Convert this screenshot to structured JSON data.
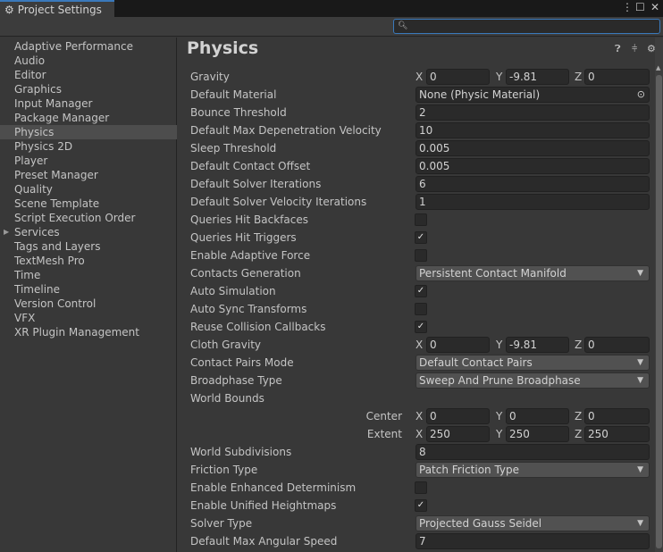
{
  "window": {
    "title": "Project Settings",
    "search_placeholder": ""
  },
  "sidebar": {
    "selected": "Physics",
    "items": [
      {
        "label": "Adaptive Performance"
      },
      {
        "label": "Audio"
      },
      {
        "label": "Editor"
      },
      {
        "label": "Graphics"
      },
      {
        "label": "Input Manager"
      },
      {
        "label": "Package Manager"
      },
      {
        "label": "Physics"
      },
      {
        "label": "Physics 2D"
      },
      {
        "label": "Player"
      },
      {
        "label": "Preset Manager"
      },
      {
        "label": "Quality"
      },
      {
        "label": "Scene Template"
      },
      {
        "label": "Script Execution Order"
      },
      {
        "label": "Services",
        "expandable": true
      },
      {
        "label": "Tags and Layers"
      },
      {
        "label": "TextMesh Pro"
      },
      {
        "label": "Time"
      },
      {
        "label": "Timeline"
      },
      {
        "label": "Version Control"
      },
      {
        "label": "VFX"
      },
      {
        "label": "XR Plugin Management"
      }
    ]
  },
  "main": {
    "title": "Physics",
    "rows": [
      {
        "label": "Gravity",
        "type": "vector",
        "x": "0",
        "y": "-9.81",
        "z": "0"
      },
      {
        "label": "Default Material",
        "type": "object",
        "value": "None (Physic Material)"
      },
      {
        "label": "Bounce Threshold",
        "type": "text",
        "value": "2"
      },
      {
        "label": "Default Max Depenetration Velocity",
        "type": "text",
        "value": "10"
      },
      {
        "label": "Sleep Threshold",
        "type": "text",
        "value": "0.005"
      },
      {
        "label": "Default Contact Offset",
        "type": "text",
        "value": "0.005"
      },
      {
        "label": "Default Solver Iterations",
        "type": "text",
        "value": "6"
      },
      {
        "label": "Default Solver Velocity Iterations",
        "type": "text",
        "value": "1"
      },
      {
        "label": "Queries Hit Backfaces",
        "type": "check",
        "checked": false
      },
      {
        "label": "Queries Hit Triggers",
        "type": "check",
        "checked": true
      },
      {
        "label": "Enable Adaptive Force",
        "type": "check",
        "checked": false
      },
      {
        "label": "Contacts Generation",
        "type": "dropdown",
        "value": "Persistent Contact Manifold"
      },
      {
        "label": "Auto Simulation",
        "type": "check",
        "checked": true
      },
      {
        "label": "Auto Sync Transforms",
        "type": "check",
        "checked": false
      },
      {
        "label": "Reuse Collision Callbacks",
        "type": "check",
        "checked": true
      },
      {
        "label": "Cloth Gravity",
        "type": "vector",
        "x": "0",
        "y": "-9.81",
        "z": "0"
      },
      {
        "label": "Contact Pairs Mode",
        "type": "dropdown",
        "value": "Default Contact Pairs"
      },
      {
        "label": "Broadphase Type",
        "type": "dropdown",
        "value": "Sweep And Prune Broadphase"
      },
      {
        "label": "World Bounds",
        "type": "header"
      },
      {
        "label": "Center",
        "type": "vector",
        "sub": true,
        "x": "0",
        "y": "0",
        "z": "0"
      },
      {
        "label": "Extent",
        "type": "vector",
        "sub": true,
        "x": "250",
        "y": "250",
        "z": "250"
      },
      {
        "label": "World Subdivisions",
        "type": "text",
        "value": "8"
      },
      {
        "label": "Friction Type",
        "type": "dropdown",
        "value": "Patch Friction Type"
      },
      {
        "label": "Enable Enhanced Determinism",
        "type": "check",
        "checked": false
      },
      {
        "label": "Enable Unified Heightmaps",
        "type": "check",
        "checked": true
      },
      {
        "label": "Solver Type",
        "type": "dropdown",
        "value": "Projected Gauss Seidel"
      },
      {
        "label": "Default Max Angular Speed",
        "type": "text",
        "value": "7"
      }
    ]
  },
  "axis_labels": {
    "x": "X",
    "y": "Y",
    "z": "Z"
  },
  "icons": {
    "tab": "gear-icon",
    "menu": "kebab-icon",
    "maximize": "maximize-icon",
    "close": "close-icon",
    "search": "search-icon",
    "help": "help-icon",
    "presets": "sliders-icon",
    "settings": "gear-icon",
    "object_picker": "target-icon",
    "dropdown": "caret-down-icon",
    "check": "checkmark-icon"
  },
  "colors": {
    "accent": "#3a79bb",
    "background": "#383838",
    "field": "#2a2a2a",
    "selected_row": "#4d4d4d"
  }
}
